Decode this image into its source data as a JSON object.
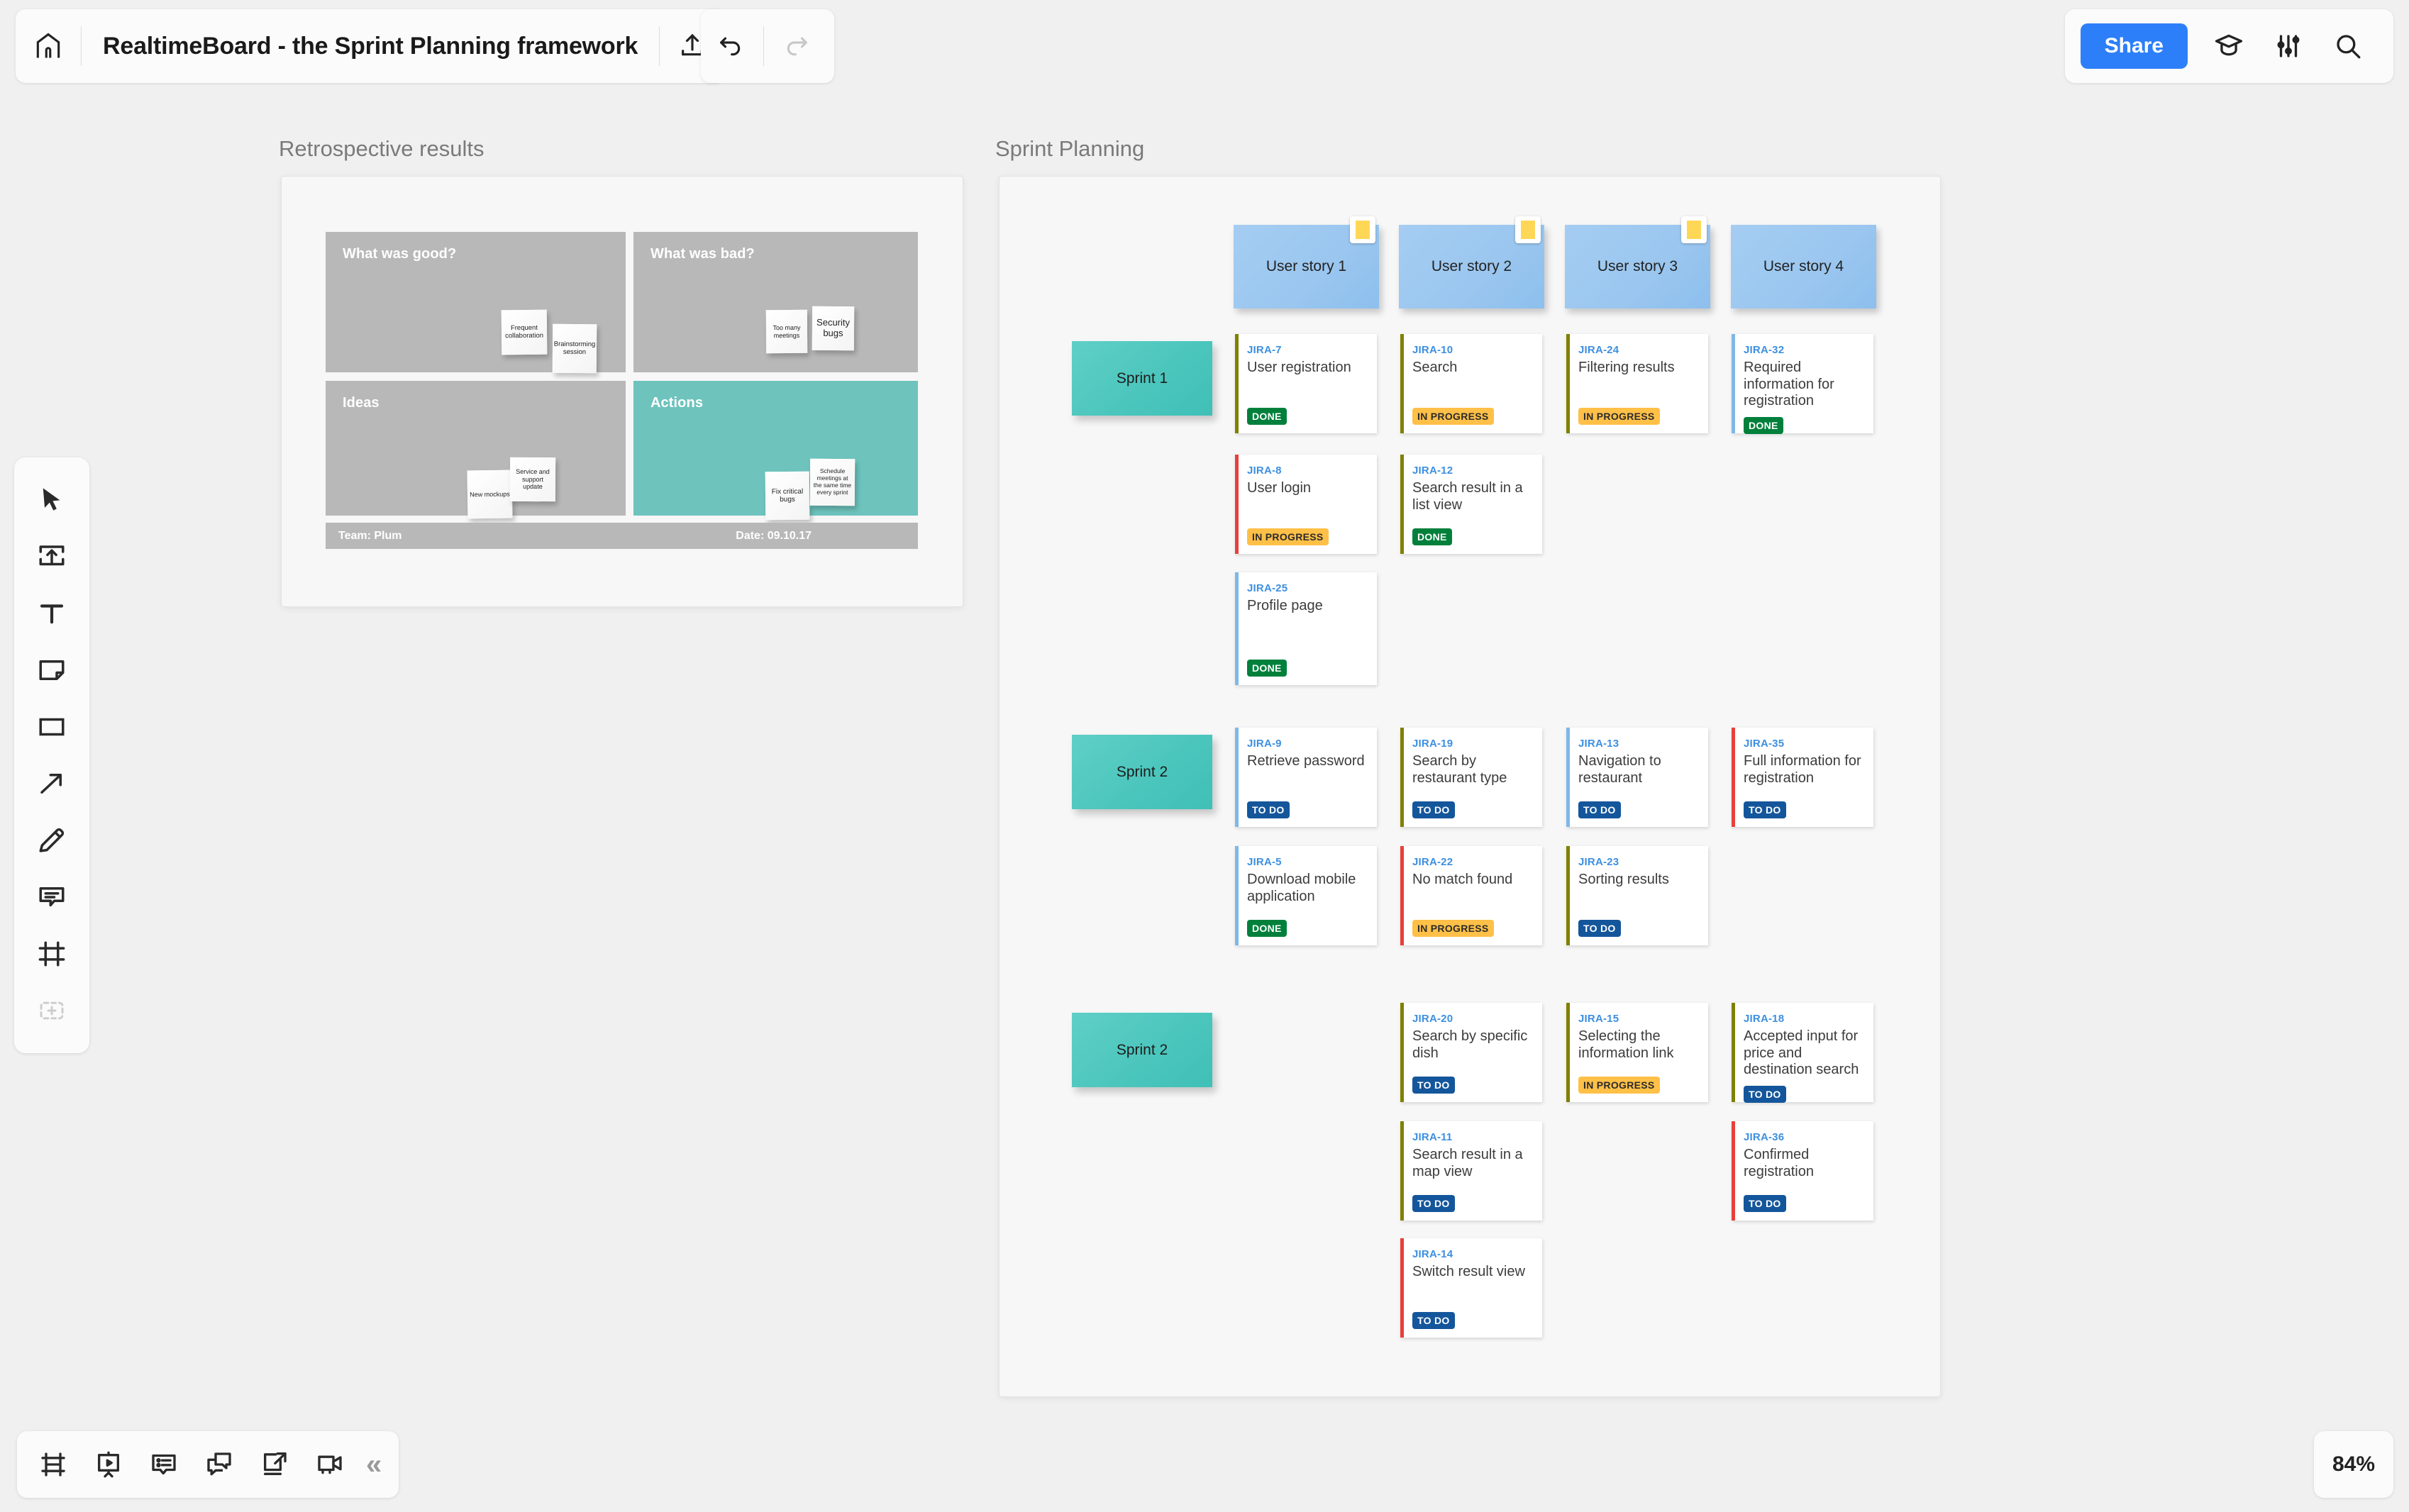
{
  "header": {
    "home_icon": "home-icon",
    "title": "RealtimeBoard - the Sprint Planning framework",
    "upload_icon": "upload-icon",
    "undo_icon": "undo-icon",
    "redo_icon": "redo-icon",
    "share_label": "Share",
    "tutorial_icon": "graduation-cap-icon",
    "settings_icon": "sliders-icon",
    "search_icon": "search-icon"
  },
  "left_toolbar": {
    "items": [
      {
        "name": "select-tool",
        "icon": "cursor-arrow-icon"
      },
      {
        "name": "upload-tool",
        "icon": "upload-box-icon"
      },
      {
        "name": "text-tool",
        "icon": "text-t-icon"
      },
      {
        "name": "sticky-tool",
        "icon": "sticky-note-icon"
      },
      {
        "name": "shape-tool",
        "icon": "rectangle-icon"
      },
      {
        "name": "arrow-tool",
        "icon": "arrow-icon"
      },
      {
        "name": "pen-tool",
        "icon": "pencil-icon"
      },
      {
        "name": "comment-tool",
        "icon": "comment-icon"
      },
      {
        "name": "frame-tool",
        "icon": "frame-icon"
      },
      {
        "name": "add-more-tool",
        "icon": "plus-dashed-icon"
      }
    ]
  },
  "bottom_toolbar": {
    "items": [
      {
        "name": "frames-panel-button",
        "icon": "frames-icon"
      },
      {
        "name": "presentation-button",
        "icon": "presentation-play-icon"
      },
      {
        "name": "comments-button",
        "icon": "comment-list-icon"
      },
      {
        "name": "chat-button",
        "icon": "chat-bubbles-icon"
      },
      {
        "name": "export-button",
        "icon": "export-arrow-icon"
      },
      {
        "name": "video-chat-button",
        "icon": "video-camera-icon"
      }
    ],
    "collapse_label": "«"
  },
  "zoom": {
    "level": "84%"
  },
  "retro": {
    "frame_title": "Retrospective results",
    "quadrants": [
      {
        "label": "What was good?",
        "accent": "#b8b8b8"
      },
      {
        "label": "What was bad?",
        "accent": "#b8b8b8"
      },
      {
        "label": "Ideas",
        "accent": "#b8b8b8"
      },
      {
        "label": "Actions",
        "accent": "#6ec3bd"
      }
    ],
    "notes": {
      "good": [
        {
          "text": "Frequent collaboration"
        },
        {
          "text": "Brainstorming session"
        }
      ],
      "bad": [
        {
          "text": "Too many meetings"
        },
        {
          "text": "Security bugs"
        }
      ],
      "ideas": [
        {
          "text": "New mockups"
        },
        {
          "text": "Service and support update"
        }
      ],
      "actions": [
        {
          "text": "Fix critical bugs"
        },
        {
          "text": "Schedule meetings at the same time every sprint"
        }
      ]
    },
    "footer": {
      "team": "Team: Plum",
      "date": "Date: 09.10.17"
    }
  },
  "sprint": {
    "frame_title": "Sprint Planning",
    "user_stories": [
      {
        "label": "User story 1",
        "has_tag": true
      },
      {
        "label": "User story 2",
        "has_tag": true
      },
      {
        "label": "User story 3",
        "has_tag": true
      },
      {
        "label": "User story 4",
        "has_tag": false
      }
    ],
    "sprints": [
      {
        "label": "Sprint 1"
      },
      {
        "label": "Sprint 2"
      },
      {
        "label": "Sprint 2"
      }
    ],
    "status_colors": {
      "DONE": "#00803b",
      "IN PROGRESS": "#ffc048",
      "TO DO": "#14569b"
    },
    "rows": [
      {
        "sprint": "Sprint 1",
        "columns": [
          [
            {
              "key": "JIRA-7",
              "title": "User registration",
              "status": "DONE",
              "accent": "#808000"
            },
            {
              "key": "JIRA-8",
              "title": "User login",
              "status": "IN PROGRESS",
              "accent": "#e8403a"
            },
            {
              "key": "JIRA-25",
              "title": "Profile page",
              "status": "DONE",
              "accent": "#7eb8e8"
            }
          ],
          [
            {
              "key": "JIRA-10",
              "title": "Search",
              "status": "IN PROGRESS",
              "accent": "#808000"
            },
            {
              "key": "JIRA-12",
              "title": "Search result in a list view",
              "status": "DONE",
              "accent": "#808000"
            }
          ],
          [
            {
              "key": "JIRA-24",
              "title": "Filtering results",
              "status": "IN PROGRESS",
              "accent": "#808000"
            }
          ],
          [
            {
              "key": "JIRA-32",
              "title": "Required information for registration",
              "status": "DONE",
              "accent": "#7eb8e8"
            }
          ]
        ]
      },
      {
        "sprint": "Sprint 2",
        "columns": [
          [
            {
              "key": "JIRA-9",
              "title": "Retrieve password",
              "status": "TO DO",
              "accent": "#7eb8e8"
            },
            {
              "key": "JIRA-5",
              "title": "Download mobile application",
              "status": "DONE",
              "accent": "#7eb8e8"
            }
          ],
          [
            {
              "key": "JIRA-19",
              "title": "Search by restaurant type",
              "status": "TO DO",
              "accent": "#808000"
            },
            {
              "key": "JIRA-22",
              "title": "No match found",
              "status": "IN PROGRESS",
              "accent": "#e8403a"
            }
          ],
          [
            {
              "key": "JIRA-13",
              "title": "Navigation to restaurant",
              "status": "TO DO",
              "accent": "#7eb8e8"
            },
            {
              "key": "JIRA-23",
              "title": "Sorting results",
              "status": "TO DO",
              "accent": "#808000"
            }
          ],
          [
            {
              "key": "JIRA-35",
              "title": "Full information for registration",
              "status": "TO DO",
              "accent": "#e8403a"
            }
          ]
        ]
      },
      {
        "sprint": "Sprint 2",
        "columns": [
          [],
          [
            {
              "key": "JIRA-20",
              "title": "Search by specific dish",
              "status": "TO DO",
              "accent": "#808000"
            },
            {
              "key": "JIRA-11",
              "title": "Search result in a map view",
              "status": "TO DO",
              "accent": "#808000"
            },
            {
              "key": "JIRA-14",
              "title": "Switch result view",
              "status": "TO DO",
              "accent": "#e8403a"
            }
          ],
          [
            {
              "key": "JIRA-15",
              "title": "Selecting the information link",
              "status": "IN PROGRESS",
              "accent": "#808000"
            }
          ],
          [
            {
              "key": "JIRA-18",
              "title": "Accepted input for price and destination search",
              "status": "TO DO",
              "accent": "#808000"
            },
            {
              "key": "JIRA-36",
              "title": "Confirmed registration",
              "status": "TO DO",
              "accent": "#e8403a"
            }
          ]
        ]
      }
    ]
  }
}
